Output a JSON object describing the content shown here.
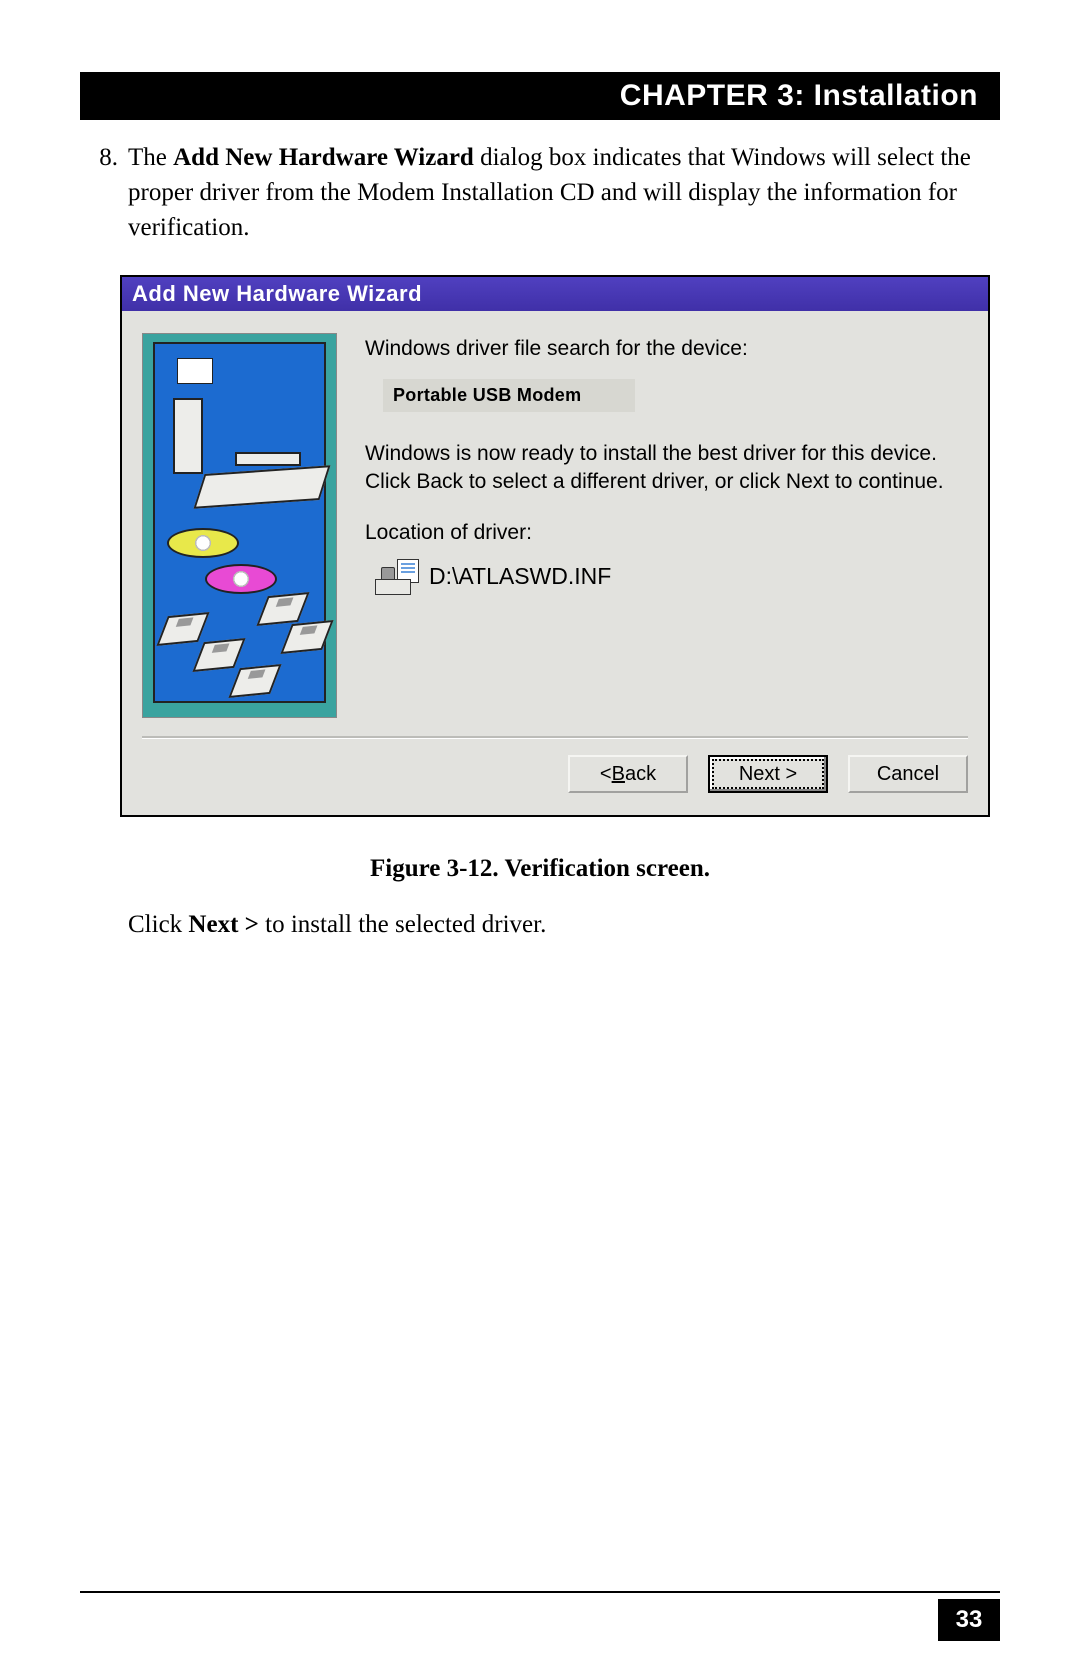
{
  "header": {
    "title": "CHAPTER 3: Installation"
  },
  "step": {
    "number": "8.",
    "pre": "The ",
    "bold": "Add New Hardware Wizard",
    "post": " dialog box indicates that Windows will select the proper driver from the Modem Installation CD and will display the information for verification."
  },
  "dialog": {
    "title": "Add New Hardware Wizard",
    "search_label": "Windows driver file search for the device:",
    "device_name": "Portable USB Modem",
    "ready_text": "Windows is now ready to install the best driver for this device. Click Back to select a different driver, or click Next to continue.",
    "location_label": "Location of driver:",
    "driver_path": "D:\\ATLASWD.INF",
    "buttons": {
      "back_prefix": "< ",
      "back_u": "B",
      "back_rest": "ack",
      "next_label": "Next >",
      "cancel": "Cancel"
    }
  },
  "figure_caption": "Figure 3-12. Verification screen.",
  "post_instruction": {
    "pre": "Click ",
    "bold": "Next >",
    "post": " to install the selected driver."
  },
  "page_number": "33"
}
